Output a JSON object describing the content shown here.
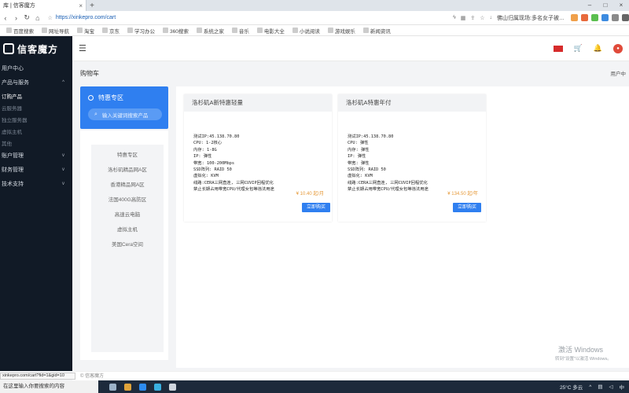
{
  "browser": {
    "tab_title": "库 | 信客魔方",
    "url": "https://xinkepro.com/cart",
    "news_text": "佛山归属现场:多名女子被…",
    "bookmarks": [
      "百度搜索",
      "网址导航",
      "淘宝",
      "京东",
      "学习办公",
      "360搜索",
      "系统之家",
      "音乐",
      "电影大全",
      "小说阅读",
      "游戏娱乐",
      "新闻资讯"
    ],
    "status_url": "xinkepro.com/cart?fid=1&gid=10"
  },
  "sidebar": {
    "logo": "信客魔方",
    "items": [
      {
        "label": "用户中心",
        "type": "item",
        "arrow": ""
      },
      {
        "label": "产品与服务",
        "type": "item",
        "arrow": "^"
      },
      {
        "label": "订购产品",
        "type": "sub",
        "active": true
      },
      {
        "label": "云服务器",
        "type": "sub"
      },
      {
        "label": "独立服务器",
        "type": "sub"
      },
      {
        "label": "虚拟主机",
        "type": "sub"
      },
      {
        "label": "其他",
        "type": "sub"
      },
      {
        "label": "账户管理",
        "type": "item",
        "arrow": "v"
      },
      {
        "label": "财务管理",
        "type": "item",
        "arrow": "v"
      },
      {
        "label": "技术支持",
        "type": "item",
        "arrow": "v"
      }
    ]
  },
  "header": {
    "page_title": "购物车",
    "breadcrumb": "用户中"
  },
  "promo": {
    "title": "特惠专区",
    "search_placeholder": "输入关键词搜索产品"
  },
  "categories": [
    "特惠专区",
    "洛杉矶精品网A区",
    "香港精品网A区",
    "法国400G高防区",
    "高速云电脑",
    "虚拟主机",
    "美国Cera空间"
  ],
  "products": [
    {
      "name": "洛杉矶A新特惠轻量",
      "specs": [
        "测试IP:45.138.70.80",
        "CPU: 1-2核心",
        "内存: 1-8G",
        "IP: 弹性",
        "带宽: 100-200Mbps",
        "SSD阵列: RAID 50",
        "虚拟化: KVM",
        "线路:CERA三网直连, 三网CUVIP回程优化",
        "禁止长期占用带宽CPU/代理女包等违法用途"
      ],
      "price": "¥ 10.40 起/月",
      "buy_label": "立即购买"
    },
    {
      "name": "洛杉矶A特惠年付",
      "specs": [
        "测试IP:45.138.70.80",
        "CPU: 弹性",
        "内存: 弹性",
        "IP: 弹性",
        "带宽: 弹性",
        "SSD阵列: RAID 50",
        "虚拟化: KVM",
        "线路:CERA三网直连, 三网CUVIP回程优化",
        "禁止长期占用带宽CPU/代理女包等违法用途"
      ],
      "price": "¥ 134.50 起/年",
      "buy_label": "立即购买"
    }
  ],
  "footer": {
    "text": "© 信客魔方"
  },
  "watermark": {
    "title": "激活 Windows",
    "subtitle": "转到\"设置\"以激活 Windows。"
  },
  "taskbar": {
    "search_placeholder": "在这里输入你要搜索的内容",
    "weather": "25°C 多云",
    "lang": "中"
  },
  "colors": {
    "accent": "#2f7ff0",
    "sidebar_bg": "#111a26",
    "price": "#e69a3a"
  }
}
